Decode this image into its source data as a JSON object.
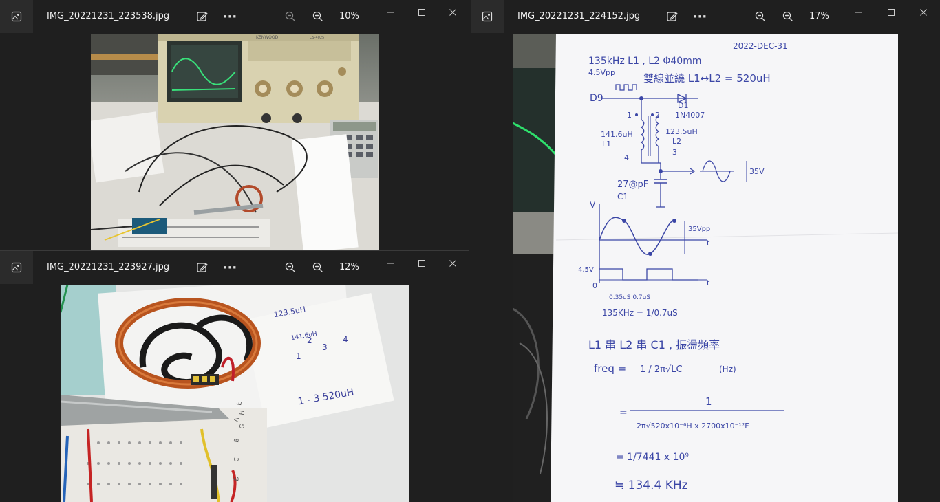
{
  "windows": [
    {
      "id": "a",
      "title": "IMG_20221231_223538.jpg",
      "zoom": "10%",
      "more_label": "···"
    },
    {
      "id": "b",
      "title": "IMG_20221231_223927.jpg",
      "zoom": "12%",
      "more_label": "···"
    },
    {
      "id": "c",
      "title": "IMG_20221231_224152.jpg",
      "zoom": "17%",
      "more_label": "···"
    }
  ],
  "photo_a": {
    "brand": "KENWOOD",
    "model": "CS-4025"
  },
  "photo_b": {
    "note_top": "123.5uH",
    "note_mid": "141.6uH",
    "pins": [
      "1",
      "2",
      "3",
      "4"
    ],
    "note_bottom": "1 - 3   520uH",
    "breadboard_rows": [
      "A",
      "B",
      "C",
      "D",
      "E",
      "G",
      "H"
    ]
  },
  "photo_c": {
    "date": "2022-DEC-31",
    "l1": "135kHz  L1 , L2  Φ40mm",
    "l2": "4.5Vpp",
    "l3": "雙線並繞  L1↔L2 = 520uH",
    "d9": "D9",
    "d1": "D1",
    "d1_part": "1N4007",
    "pin1": "1",
    "pin2": "2",
    "l1_value": "141.6uH",
    "l1_name": "L1",
    "pin4": "4",
    "l2_value": "123.5uH",
    "l2_name": "L2",
    "pin3": "3",
    "amp": "35V",
    "cap": "27@pF",
    "cap_name": "C1",
    "axis_v": "V",
    "vpp": "35Vpp",
    "t_axis": "t",
    "v45": "4.5V",
    "zero": "0",
    "times": "0.35uS  0.7uS",
    "freq_calc": "135KHz = 1/0.7uS",
    "series": "L1 串 L2 串 C1 , 振盪頻率",
    "freq_word": "freq =",
    "formula": "1 / 2π√LC",
    "unit": "(Hz)",
    "step_one": "1",
    "step_two": "2π√520x10⁻⁶H x 2700x10⁻¹²F",
    "step_three": "= 1/7441 x 10⁹",
    "result": "≒ 134.4 KHz"
  }
}
